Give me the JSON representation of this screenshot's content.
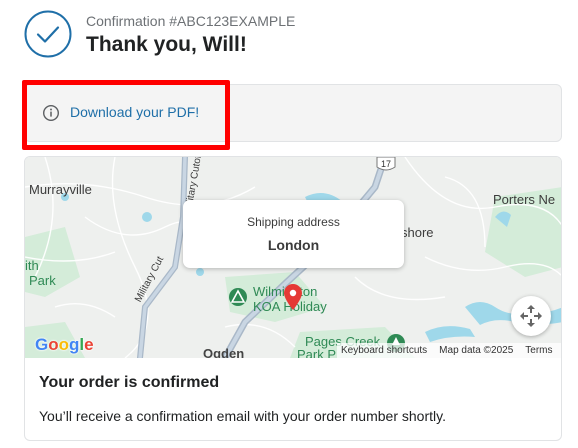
{
  "header": {
    "confirmation": "Confirmation #ABC123EXAMPLE",
    "thanks": "Thank you, Will!",
    "check_icon": "checkmark-circle-icon"
  },
  "pdf": {
    "link_label": "Download your PDF!",
    "icon": "info-icon",
    "highlight_color": "#ff0000"
  },
  "map": {
    "labels": {
      "murrayville": "Murrayville",
      "porters": "Porters Ne",
      "ith": "ith",
      "park": "Park",
      "shore": "shore",
      "wilmington": "Wilmington",
      "koa": "KOA Holiday",
      "pages_creek": "Pages Creek",
      "park_p": "Park P",
      "ogden": "Ogden",
      "military": "Military Cut",
      "military_cutoff": "Military Cutoff R",
      "route": "17"
    },
    "callout": {
      "label": "Shipping address",
      "city": "London"
    },
    "attribution": {
      "shortcuts": "Keyboard shortcuts",
      "data": "Map data ©2025",
      "terms": "Terms"
    },
    "logo": "Google",
    "fullscreen_icon": "fullscreen-icon",
    "pin_icon": "map-pin-icon"
  },
  "order": {
    "title": "Your order is confirmed",
    "message": "You’ll receive a confirmation email with your order number shortly."
  },
  "colors": {
    "accent": "#1f6fa8",
    "pin": "#e53935",
    "park_green": "#2f8a55",
    "water": "#8fd3e8"
  }
}
